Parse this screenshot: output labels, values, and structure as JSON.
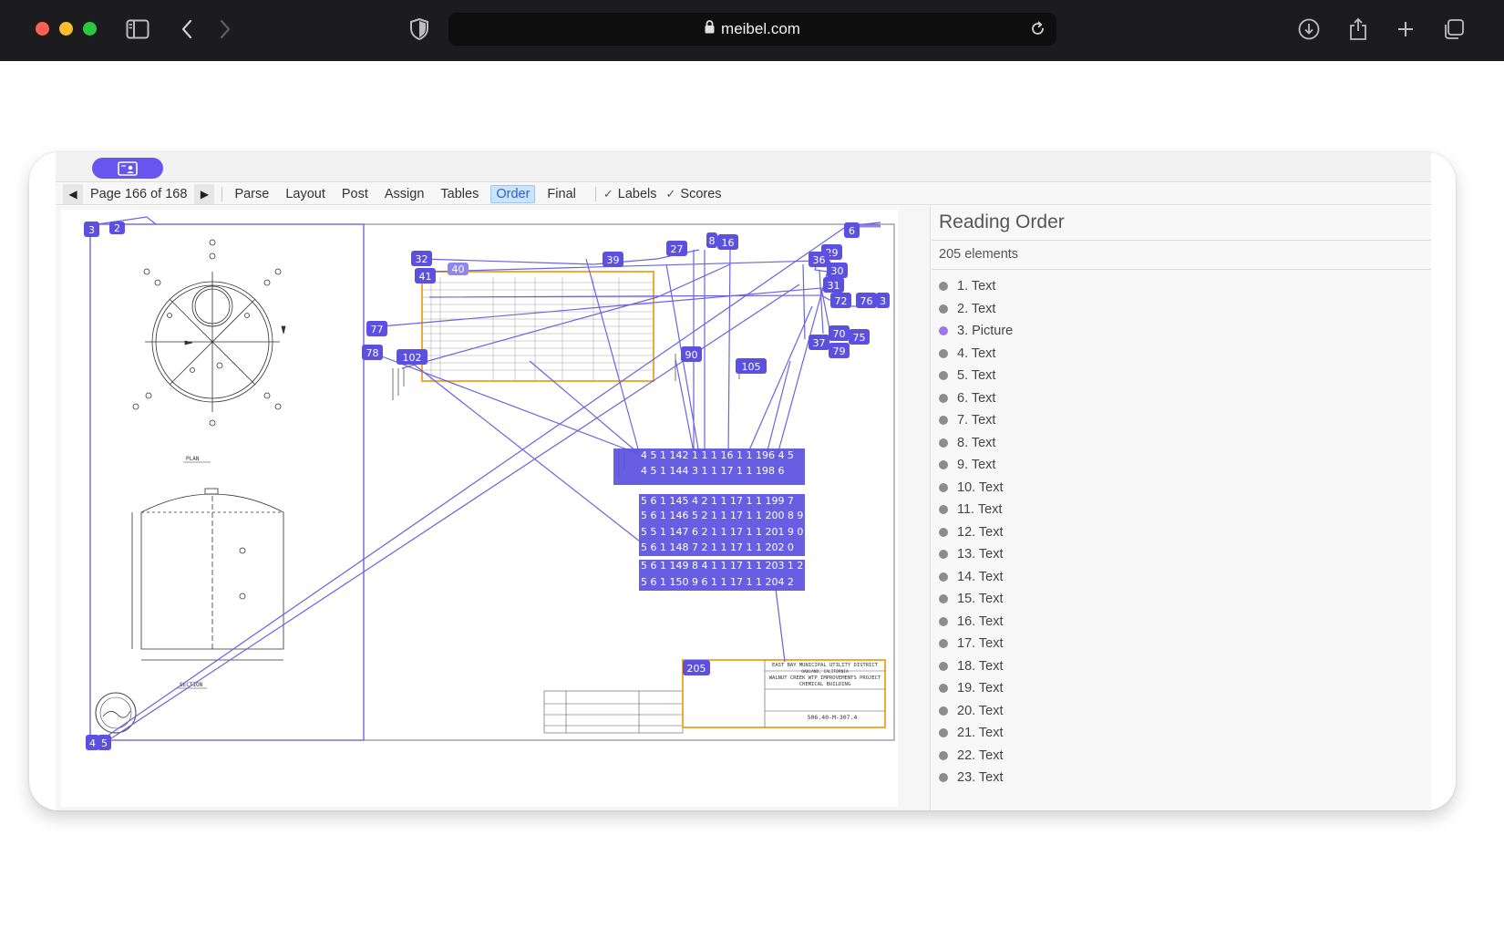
{
  "browser": {
    "url": "meibel.com",
    "colors": {
      "chrome": "#1c1c1e",
      "red": "#ff5f57",
      "yellow": "#febc2e",
      "green": "#28c840"
    },
    "icons": [
      "sidebar-icon",
      "back-icon",
      "forward-icon",
      "shield-icon",
      "lock-icon",
      "reload-icon",
      "download-icon",
      "share-icon",
      "plus-icon",
      "tabs-icon"
    ]
  },
  "toolbar": {
    "page_label": "Page 166 of 168",
    "steps": [
      "Parse",
      "Layout",
      "Post",
      "Assign",
      "Tables",
      "Order",
      "Final"
    ],
    "active_step": "Order",
    "checks": [
      "Labels",
      "Scores"
    ],
    "accent": "#6655ee"
  },
  "panel": {
    "title": "Reading Order",
    "count": "205 elements",
    "items": [
      {
        "label": "1. Text",
        "kind": "text"
      },
      {
        "label": "2. Text",
        "kind": "text"
      },
      {
        "label": "3. Picture",
        "kind": "picture"
      },
      {
        "label": "4. Text",
        "kind": "text"
      },
      {
        "label": "5. Text",
        "kind": "text"
      },
      {
        "label": "6. Text",
        "kind": "text"
      },
      {
        "label": "7. Text",
        "kind": "text"
      },
      {
        "label": "8. Text",
        "kind": "text"
      },
      {
        "label": "9. Text",
        "kind": "text"
      },
      {
        "label": "10. Text",
        "kind": "text"
      },
      {
        "label": "11. Text",
        "kind": "text"
      },
      {
        "label": "12. Text",
        "kind": "text"
      },
      {
        "label": "13. Text",
        "kind": "text"
      },
      {
        "label": "14. Text",
        "kind": "text"
      },
      {
        "label": "15. Text",
        "kind": "text"
      },
      {
        "label": "16. Text",
        "kind": "text"
      },
      {
        "label": "17. Text",
        "kind": "text"
      },
      {
        "label": "18. Text",
        "kind": "text"
      },
      {
        "label": "19. Text",
        "kind": "text"
      },
      {
        "label": "20. Text",
        "kind": "text"
      },
      {
        "label": "21. Text",
        "kind": "text"
      },
      {
        "label": "22. Text",
        "kind": "text"
      },
      {
        "label": "23. Text",
        "kind": "text"
      }
    ]
  },
  "drawing": {
    "badges": [
      "3",
      "2",
      "4",
      "5",
      "6",
      "32",
      "40",
      "41",
      "27",
      "8",
      "16",
      "29",
      "39",
      "36",
      "30",
      "31",
      "72",
      "76",
      "3",
      "77",
      "78",
      "102",
      "90",
      "105",
      "70",
      "75",
      "37",
      "79",
      "205"
    ],
    "cluster_rows": [
      "4 5 1 142 1 1 1 16 1 1 196 4 5",
      "4 5 1 144 3 1 1 17 1 1 198 6",
      "5 6 1 145 4 2 1 1 17 1 1 199 7",
      "5 6 1 146 5 2 1 1 17 1 1 200 8 9",
      "5 5 1 147 6 2 1 1 17 1 1 201 9 0",
      "5 6 1 148 7 2 1 1 17 1 1 202 0",
      "5 6 1 149 8 4 1 1 17 1 1 203 1 2",
      "5 6 1 150 9 6 1 1 17 1 1 204 2"
    ],
    "title_block": [
      "EAST BAY MUNICIPAL UTILITY DISTRICT",
      "OAKLAND, CALIFORNIA",
      "WALNUT CREEK WTP IMPROVEMENTS PROJECT",
      "CHEMICAL BUILDING",
      "506.40-M-307.4"
    ],
    "labels": [
      "PLAN",
      "SECTION"
    ],
    "colors": {
      "order_line": "#6b63e0",
      "table_box": "#f0a020"
    }
  }
}
